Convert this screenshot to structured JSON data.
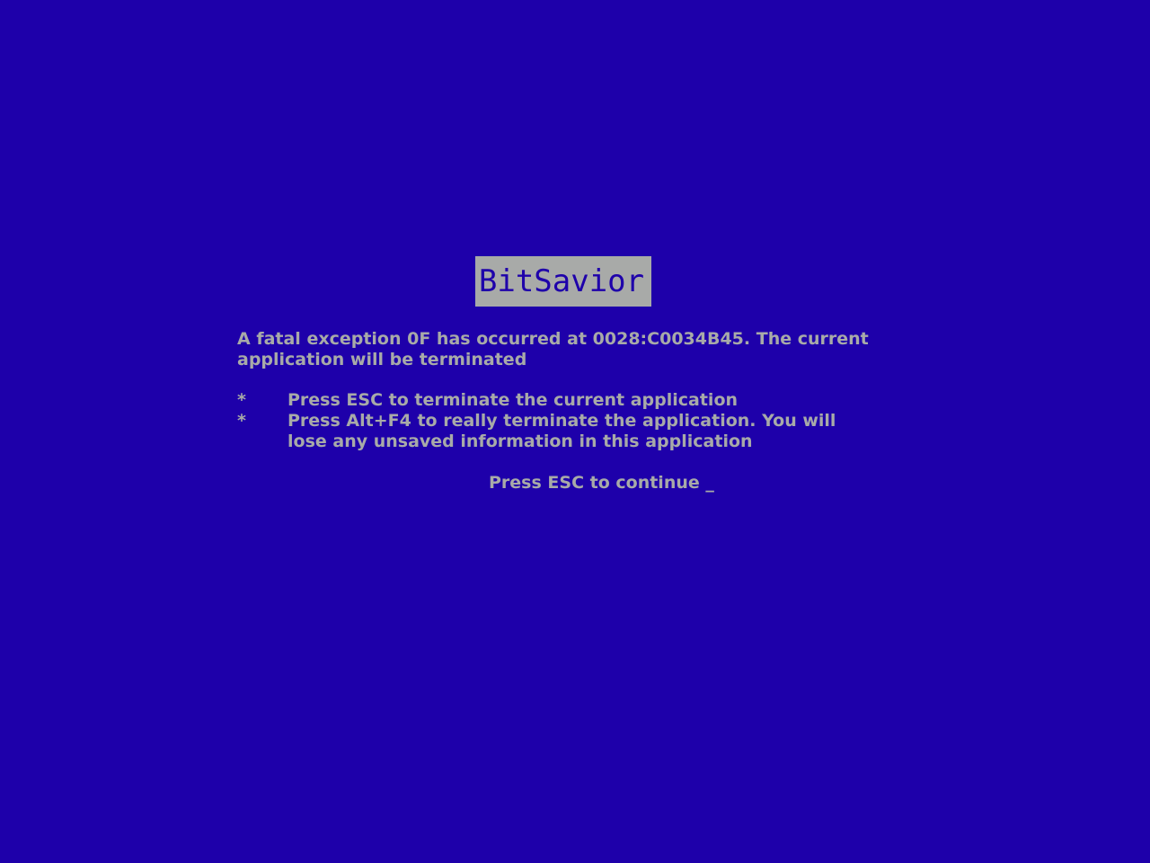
{
  "screen": {
    "background_color": "#1e00aa",
    "text_color": "#a8aaa8"
  },
  "title_badge": {
    "text": "BitSavior"
  },
  "error": {
    "message": "A fatal exception 0F has occurred at 0028:C0034B45. The current application will be terminated"
  },
  "bullets": [
    {
      "marker": "*",
      "text": "Press ESC to terminate the current application"
    },
    {
      "marker": "*",
      "text": "Press Alt+F4 to really terminate the application. You will lose any unsaved information in this application"
    }
  ],
  "prompt": {
    "text": "Press ESC to continue _"
  }
}
